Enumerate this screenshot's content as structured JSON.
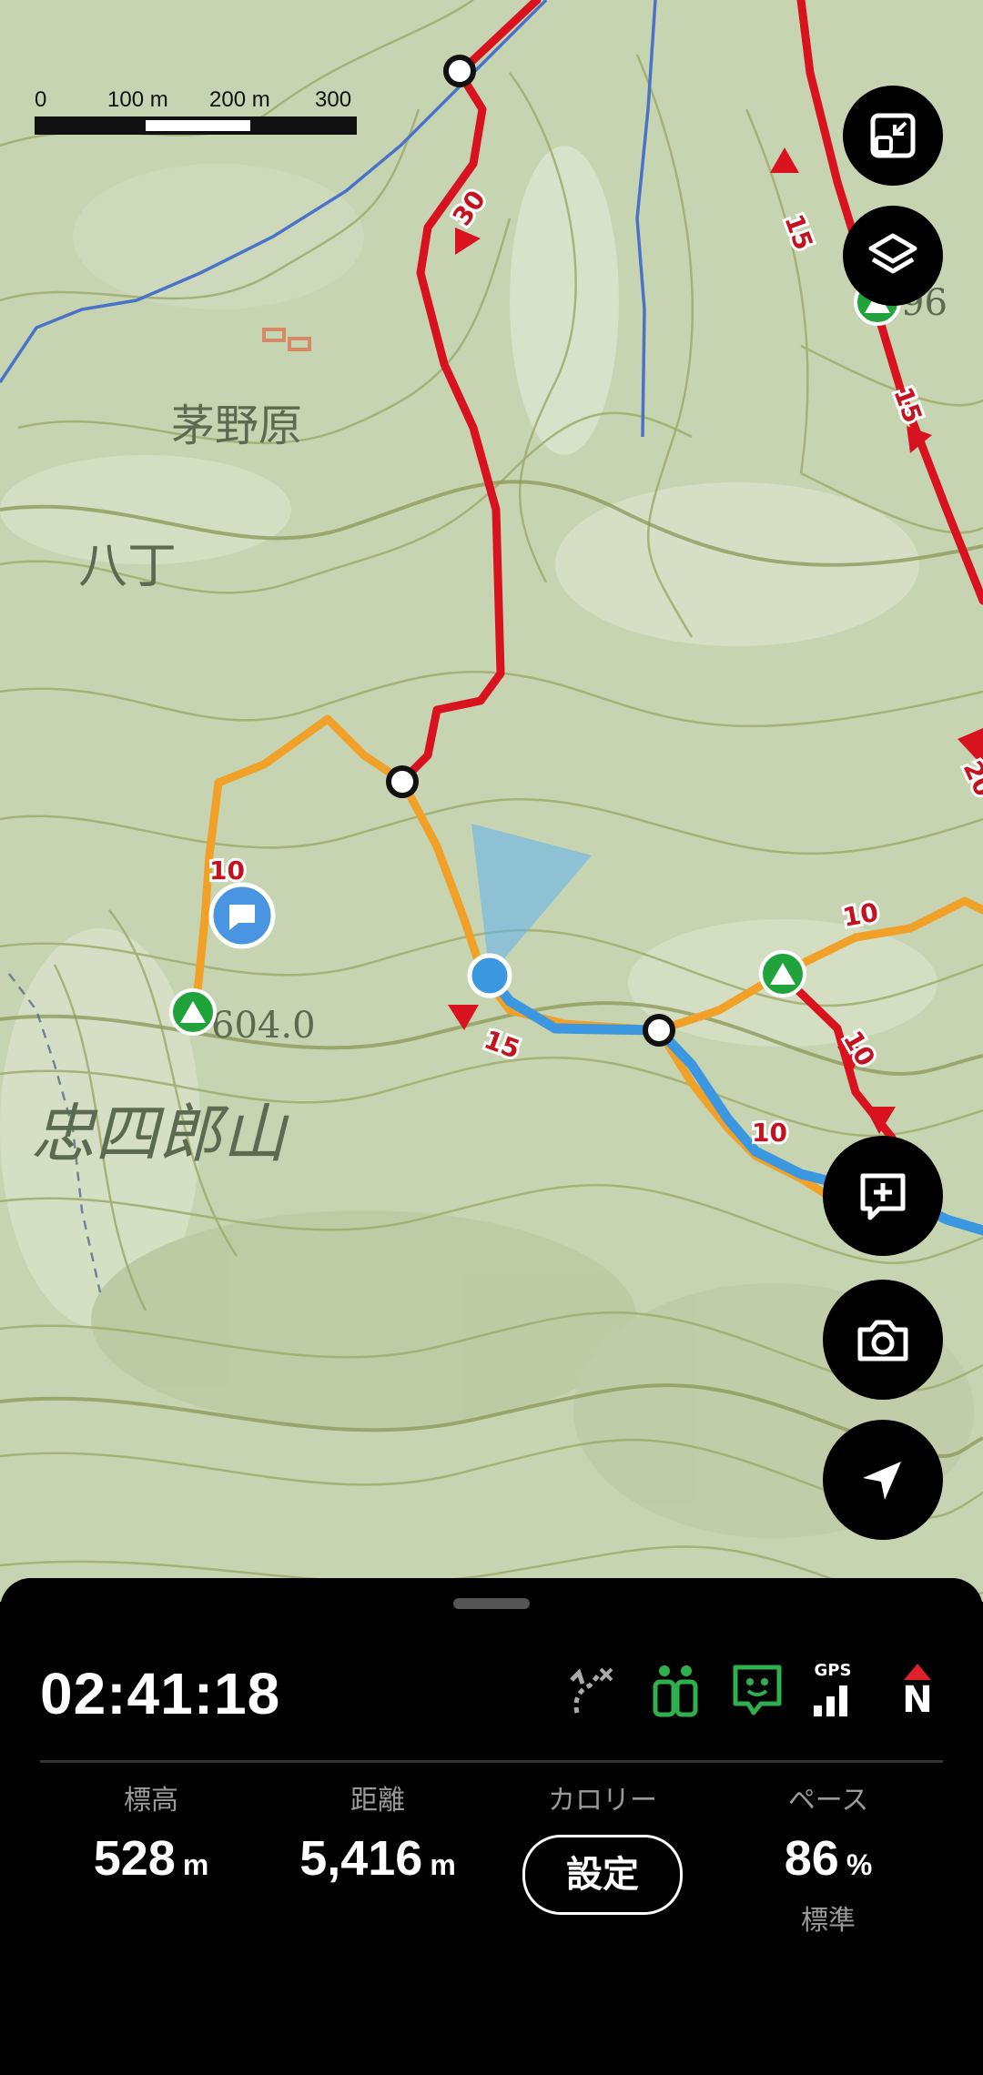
{
  "map": {
    "place_labels": [
      "茅野原",
      "八丁",
      "忠四郎山"
    ],
    "elevation_mark": "604.0",
    "partial_label": "96",
    "route_times": [
      "30",
      "15",
      "15",
      "20",
      "10",
      "10",
      "15",
      "10",
      "10"
    ]
  },
  "scale_bar": {
    "ticks": [
      "0",
      "100 m",
      "200 m",
      "300 m"
    ]
  },
  "map_controls": {
    "icons": [
      "map-fit-icon",
      "layers-icon",
      "add-note-icon",
      "camera-icon",
      "navigation-arrow-icon"
    ]
  },
  "panel": {
    "elapsed_time": "02:41:18",
    "status_icons": [
      "off-route-icon",
      "companions-icon",
      "message-icon",
      "gps-signal-icon",
      "compass-north-icon"
    ],
    "gps_label": "GPS",
    "compass_label": "N",
    "stats": {
      "elevation": {
        "label": "標高",
        "value": "528",
        "unit": "m"
      },
      "distance": {
        "label": "距離",
        "value": "5,416",
        "unit": "m"
      },
      "calories": {
        "label": "カロリー",
        "button": "設定"
      },
      "pace": {
        "label": "ペース",
        "value": "86",
        "unit": "%",
        "sub": "標準"
      }
    }
  },
  "colors": {
    "map_bg": "#c9d5b4",
    "contour": "#a3ad6f",
    "route_red": "#d8131f",
    "route_orange": "#f1a028",
    "track_blue": "#3a97e0",
    "mountain_green": "#20a33b",
    "compass_red": "#e0202a"
  }
}
